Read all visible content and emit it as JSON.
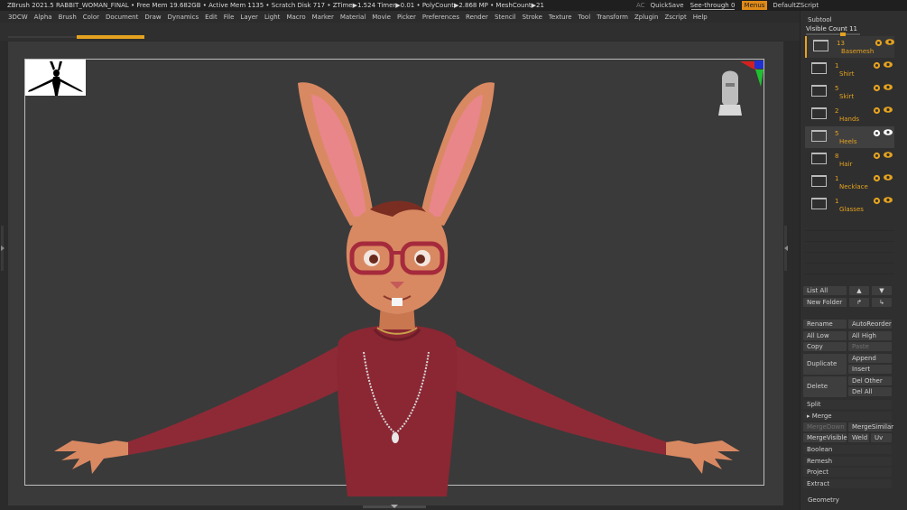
{
  "titlebar": {
    "text": "ZBrush 2021.5   RABBIT_WOMAN_FINAL   • Free Mem 19.682GB • Active Mem 1135 • Scratch Disk 717 •  ZTime▶1.524 Timer▶0.01 • PolyCount▶2.868 MP  • MeshCount▶21",
    "ac": "AC",
    "quicksave": "QuickSave",
    "see_through": "See-through   0",
    "menus": "Menus",
    "script": "DefaultZScript"
  },
  "menubar": [
    "3DCW",
    "Alpha",
    "Brush",
    "Color",
    "Document",
    "Draw",
    "Dynamics",
    "Edit",
    "File",
    "Layer",
    "Light",
    "Macro",
    "Marker",
    "Material",
    "Movie",
    "Picker",
    "Preferences",
    "Render",
    "Stencil",
    "Stroke",
    "Texture",
    "Tool",
    "Transform",
    "Zplugin",
    "Zscript",
    "Help"
  ],
  "subtool": {
    "header": "Subtool",
    "visible_count": "Visible Count 11",
    "items": [
      {
        "count": "13",
        "name": "Basemesh"
      },
      {
        "count": "1",
        "name": "Shirt"
      },
      {
        "count": "5",
        "name": "Skirt"
      },
      {
        "count": "2",
        "name": "Hands"
      },
      {
        "count": "5",
        "name": "Heels"
      },
      {
        "count": "8",
        "name": "Hair"
      },
      {
        "count": "1",
        "name": "Necklace"
      },
      {
        "count": "1",
        "name": "Glasses"
      }
    ],
    "list_all": "List All",
    "new_folder": "New Folder",
    "rename": "Rename",
    "auto_reorder": "AutoReorder",
    "all_low": "All Low",
    "all_high": "All High",
    "copy": "Copy",
    "paste": "Paste",
    "duplicate": "Duplicate",
    "append": "Append",
    "insert": "Insert",
    "delete": "Delete",
    "del_other": "Del Other",
    "del_all": "Del All",
    "split": "Split",
    "merge": "▸ Merge",
    "merge_down": "MergeDown",
    "merge_similar": "MergeSimilar",
    "merge_visible": "MergeVisible",
    "weld": "Weld",
    "uv": "Uv",
    "boolean": "Boolean",
    "remesh": "Remesh",
    "project": "Project",
    "extract": "Extract"
  },
  "geometry_header": "Geometry",
  "colors": {
    "accent": "#e5a21f",
    "shirt": "#8e2a36",
    "skin": "#d98962",
    "ear_inner": "#e8868a",
    "glasses": "#a52a3c"
  }
}
